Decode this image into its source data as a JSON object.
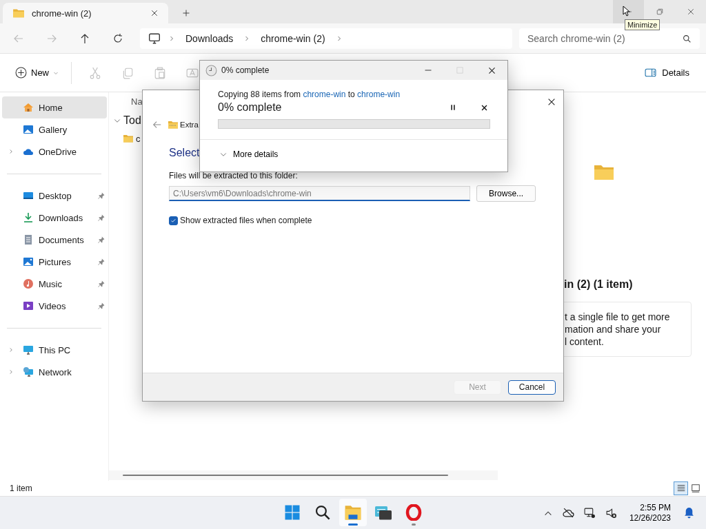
{
  "explorer": {
    "tabs": [
      {
        "label": "chrome-win (2)",
        "selected": true
      }
    ],
    "window_controls": [
      {
        "kind": "minimize",
        "hovered": true
      },
      {
        "kind": "restore",
        "hovered": false
      },
      {
        "kind": "close",
        "hovered": false
      }
    ],
    "tooltip": "Minimize",
    "nav": [
      {
        "kind": "back",
        "disabled": true
      },
      {
        "kind": "forward",
        "disabled": true
      },
      {
        "kind": "up",
        "disabled": false
      },
      {
        "kind": "refresh",
        "disabled": false
      }
    ],
    "breadcrumb": [
      "Downloads",
      "chrome-win (2)"
    ],
    "search": {
      "placeholder": "Search chrome-win (2)"
    },
    "toolbar": {
      "new": "New",
      "actions": [
        {
          "kind": "cut",
          "disabled": true
        },
        {
          "kind": "copy",
          "disabled": true
        },
        {
          "kind": "paste",
          "disabled": true
        },
        {
          "kind": "rename",
          "disabled": true
        }
      ],
      "details": "Details"
    },
    "sidebar": {
      "sections": [
        {
          "items": [
            {
              "label": "Home",
              "selected": true,
              "expandable": false,
              "pinned": false
            },
            {
              "label": "Gallery",
              "selected": false,
              "expandable": false,
              "pinned": false
            },
            {
              "label": "OneDrive",
              "selected": false,
              "expandable": true,
              "pinned": false
            }
          ]
        },
        {
          "items": [
            {
              "label": "Desktop",
              "selected": false,
              "expandable": false,
              "pinned": true
            },
            {
              "label": "Downloads",
              "selected": false,
              "expandable": false,
              "pinned": true
            },
            {
              "label": "Documents",
              "selected": false,
              "expandable": false,
              "pinned": true
            },
            {
              "label": "Pictures",
              "selected": false,
              "expandable": false,
              "pinned": true
            },
            {
              "label": "Music",
              "selected": false,
              "expandable": false,
              "pinned": true
            },
            {
              "label": "Videos",
              "selected": false,
              "expandable": false,
              "pinned": true
            }
          ]
        },
        {
          "items": [
            {
              "label": "This PC",
              "selected": false,
              "expandable": true,
              "pinned": false
            },
            {
              "label": "Network",
              "selected": false,
              "expandable": true,
              "pinned": false
            }
          ]
        }
      ]
    },
    "file_list": {
      "column_header": "Na",
      "group_header": "Tod",
      "items": [
        "c"
      ]
    },
    "details_pane": {
      "title": "in (2) (1 item)",
      "hint": "t a single file to get more\nmation and share your\nl content."
    },
    "status": "1 item",
    "views": [
      {
        "kind": "details",
        "selected": true
      },
      {
        "kind": "tiles",
        "selected": false
      }
    ]
  },
  "extract_dialog": {
    "title": "Extra",
    "heading": "Select",
    "folder_label": "Files will be extracted to this folder:",
    "path": "C:\\Users\\vm6\\Downloads\\chrome-win",
    "browse": "Browse...",
    "show_files": {
      "label": "Show extracted files when complete",
      "checked": true
    },
    "buttons": [
      {
        "label": "Next",
        "disabled": true
      },
      {
        "label": "Cancel",
        "disabled": false
      }
    ]
  },
  "copy_dialog": {
    "title": "0% complete",
    "maximize_disabled": true,
    "message": {
      "prefix": "Copying 88 items from",
      "source": "chrome-win",
      "middle": "to",
      "destination": "chrome-win"
    },
    "status": "0% complete",
    "level": 0,
    "more": "More details"
  },
  "taskbar": {
    "apps": [
      {
        "kind": "start",
        "active": false,
        "running": false
      },
      {
        "kind": "search",
        "active": false,
        "running": false
      },
      {
        "kind": "explorer",
        "active": true,
        "running": true
      },
      {
        "kind": "terminal",
        "active": false,
        "running": false
      },
      {
        "kind": "browser",
        "active": false,
        "running": true
      }
    ],
    "time": "2:55 PM",
    "date": "12/26/2023"
  }
}
